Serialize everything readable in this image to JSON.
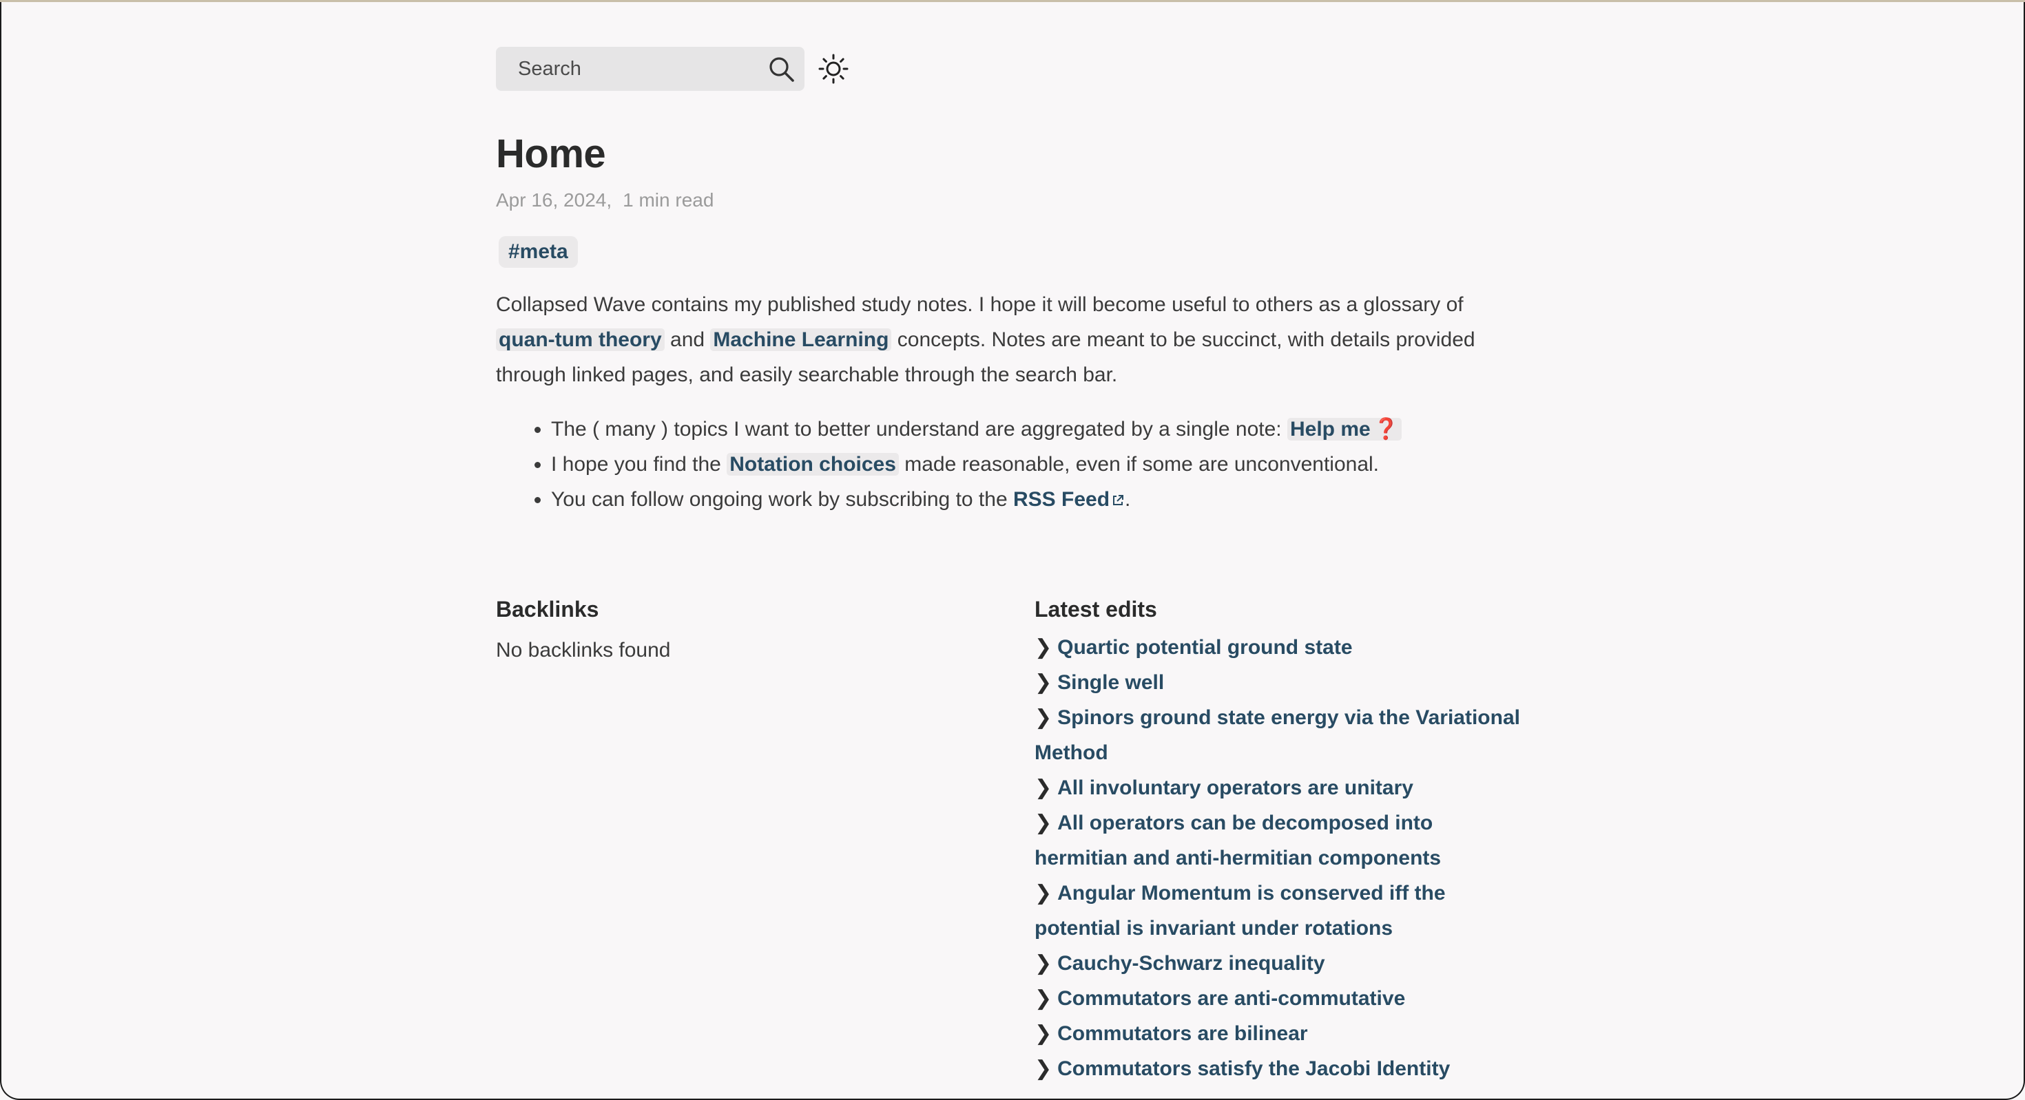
{
  "search": {
    "placeholder": "Search"
  },
  "page": {
    "title": "Home",
    "date": "Apr 16, 2024,",
    "read_time": "1 min read",
    "tag": "#meta"
  },
  "intro": {
    "text_1": "Collapsed Wave contains my published study notes. I hope it will become useful to others as a glossary of ",
    "link_quantum": "quan-tum theory",
    "text_2": " and ",
    "link_ml": "Machine Learning",
    "text_3": " concepts. Notes are meant to be succinct, with details provided through linked pages, and easily searchable through the search bar."
  },
  "bullets": {
    "b1_text": "The ( many ) topics I want to better understand are aggregated by a single note: ",
    "b1_link": "Help me",
    "b1_mark": "❓",
    "b2_text_1": "I hope you find the ",
    "b2_link": "Notation choices",
    "b2_text_2": " made reasonable, even if some are unconventional.",
    "b3_text_1": "You can follow ongoing work by subscribing to the ",
    "b3_link": "RSS Feed",
    "b3_text_2": "."
  },
  "backlinks": {
    "title": "Backlinks",
    "empty": "No backlinks found"
  },
  "latest_edits": {
    "title": "Latest edits",
    "items": [
      "Quartic potential ground state",
      "Single well",
      "Spinors ground state energy via the Variational Method",
      "All involuntary operators are unitary",
      "All operators can be decomposed into hermitian and anti-hermitian components",
      "Angular Momentum is conserved iff the potential is invariant under rotations",
      "Cauchy-Schwarz inequality",
      "Commutators are anti-commutative",
      "Commutators are bilinear",
      "Commutators satisfy the Jacobi Identity"
    ]
  },
  "colors": {
    "background": "#f9f7f8",
    "link": "#284b63",
    "text": "#3b3b3b",
    "muted": "#9b9b9b",
    "highlight": "#ebe9ea"
  }
}
